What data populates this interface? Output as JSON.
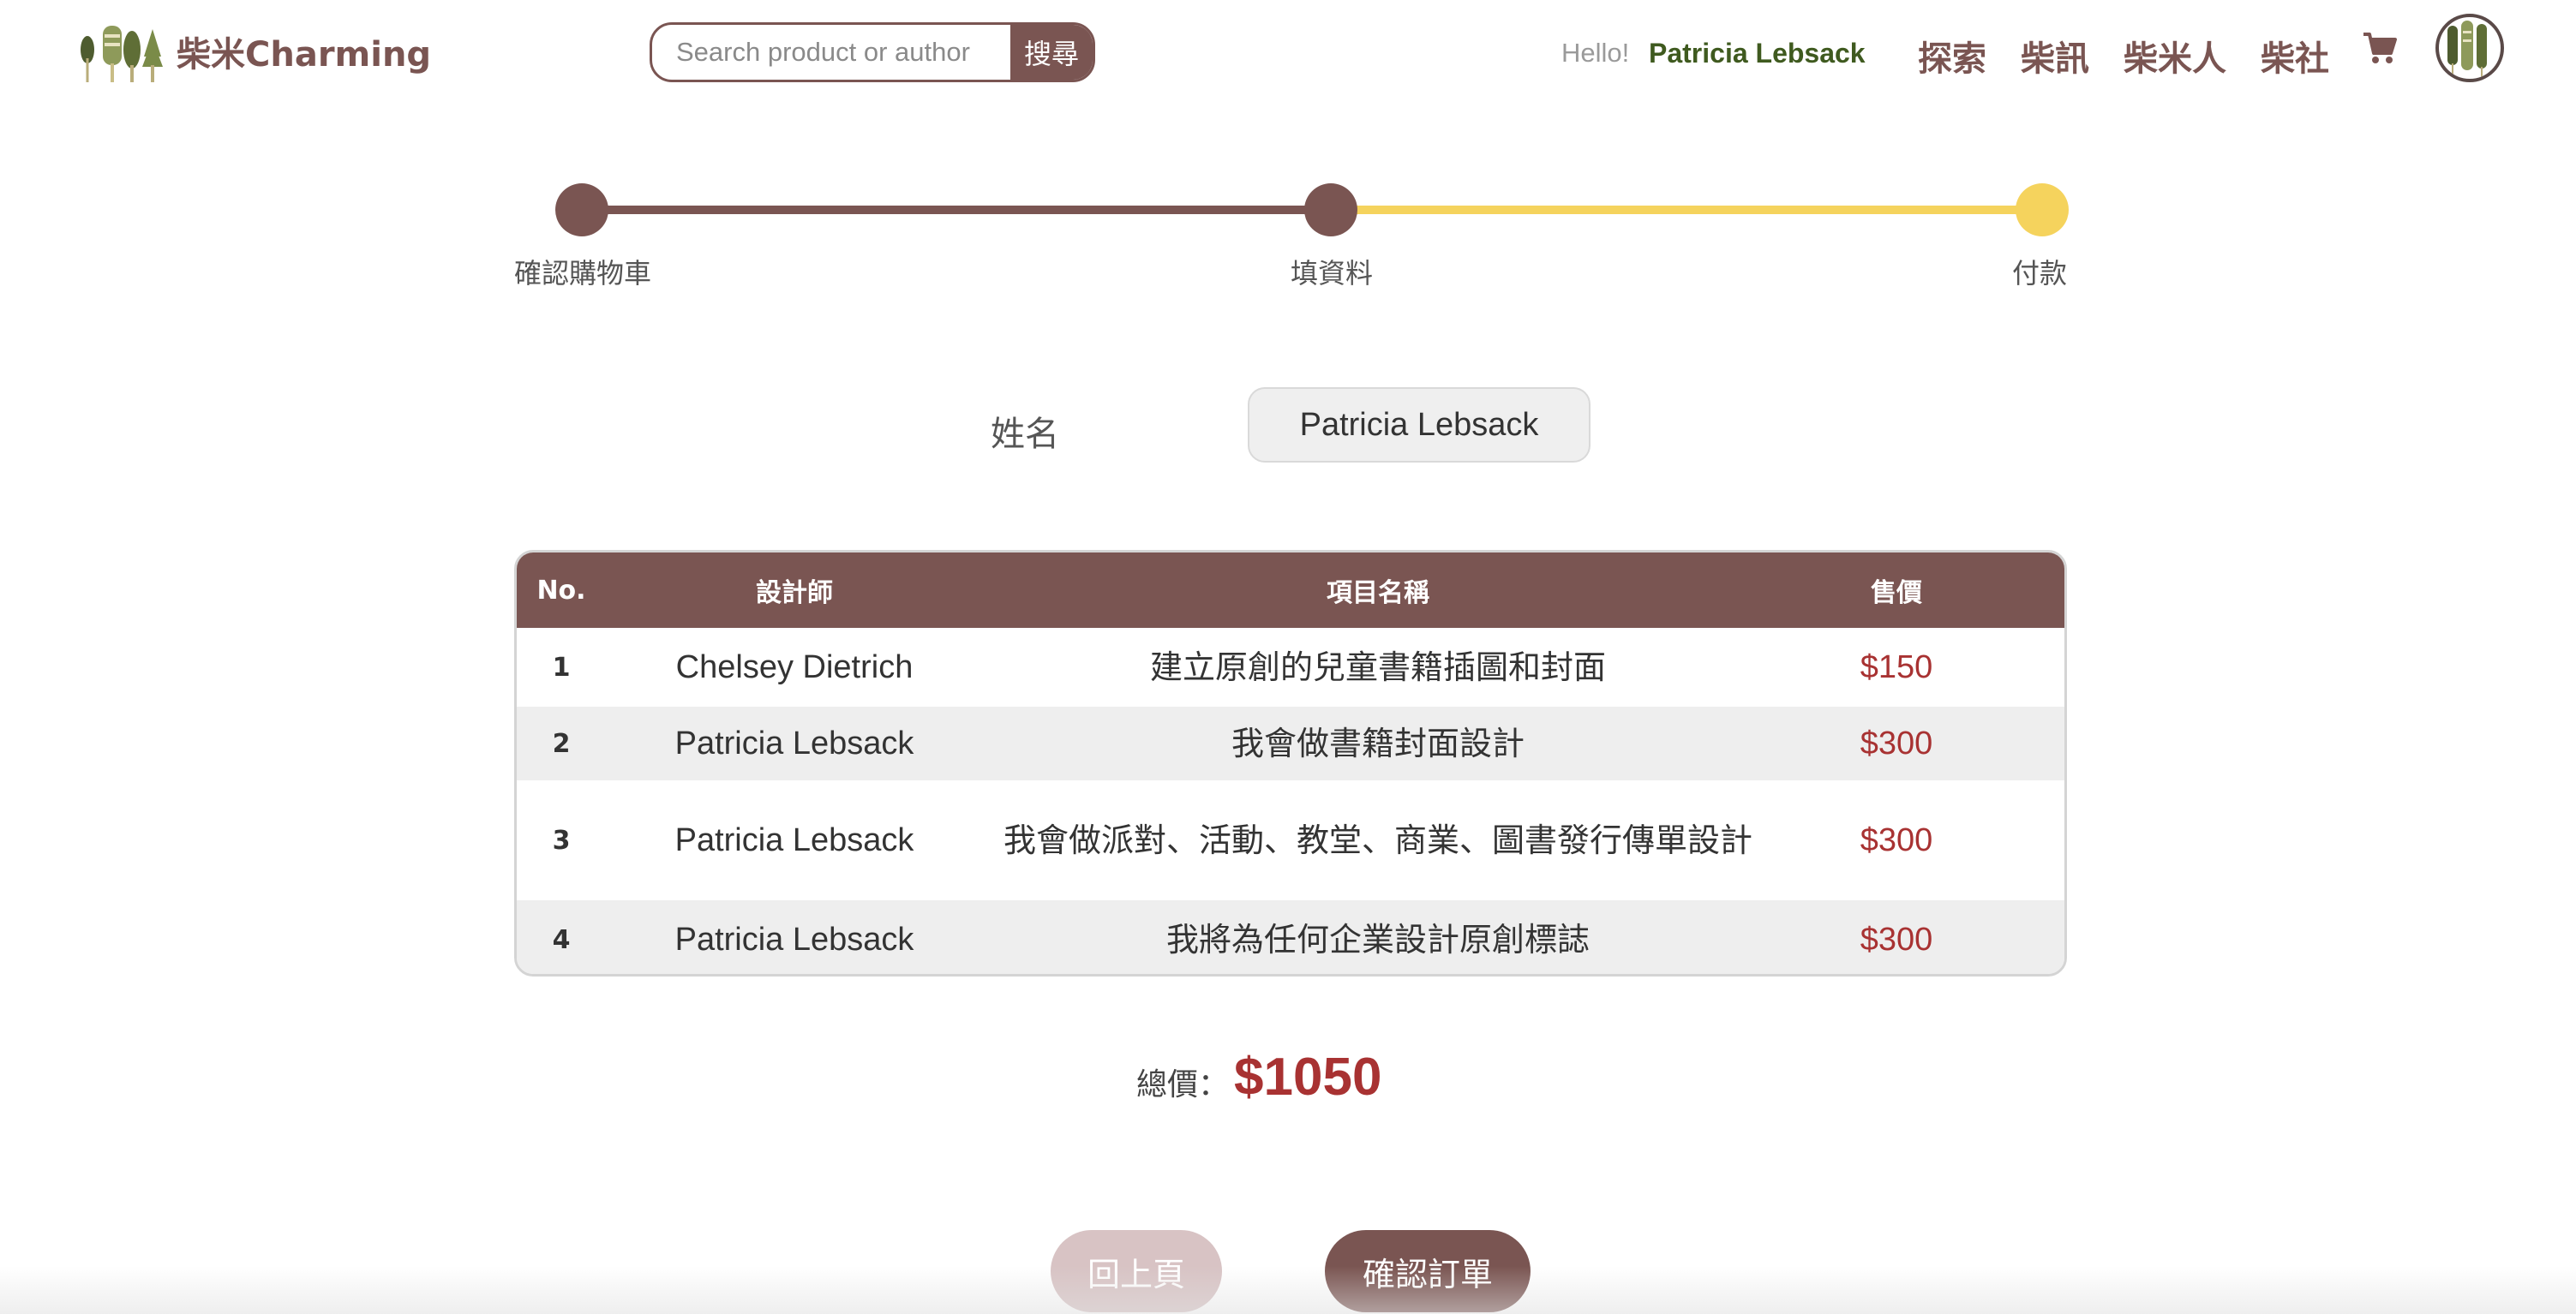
{
  "header": {
    "logo_text": "柴米Charming",
    "search_placeholder": "Search product or author",
    "search_button": "搜尋",
    "greeting": "Hello!",
    "username": "Patricia Lebsack",
    "nav": [
      "探索",
      "柴訊",
      "柴米人",
      "柴社"
    ],
    "icons": [
      "tree-logo-icon",
      "cart-icon",
      "avatar-icon"
    ]
  },
  "stepper": {
    "steps": [
      "確認購物車",
      "填資料",
      "付款"
    ],
    "current_step": 2,
    "colors": {
      "done": "#7a5552",
      "todo": "#f5d35d"
    }
  },
  "form": {
    "name_label": "姓名",
    "name_value": "Patricia Lebsack"
  },
  "table": {
    "headers": [
      "No.",
      "設計師",
      "項目名稱",
      "售價"
    ],
    "rows": [
      {
        "no": "1",
        "designer": "Chelsey Dietrich",
        "title": "建立原創的兒童書籍插圖和封面",
        "price": "$150"
      },
      {
        "no": "2",
        "designer": "Patricia Lebsack",
        "title": "我會做書籍封面設計",
        "price": "$300"
      },
      {
        "no": "3",
        "designer": "Patricia Lebsack",
        "title": "我會做派對、活動、教堂、商業、圖書發行傳單設計",
        "price": "$300"
      },
      {
        "no": "4",
        "designer": "Patricia Lebsack",
        "title": "我將為任何企業設計原創標誌",
        "price": "$300"
      }
    ]
  },
  "summary": {
    "total_label": "總價：",
    "total_value": "$1050"
  },
  "actions": {
    "back": "回上頁",
    "confirm": "確認訂單"
  },
  "colors": {
    "brand": "#7a5552",
    "accent_yellow": "#f5d35d",
    "price_red": "#a83232",
    "username_green": "#3f5a1f"
  }
}
